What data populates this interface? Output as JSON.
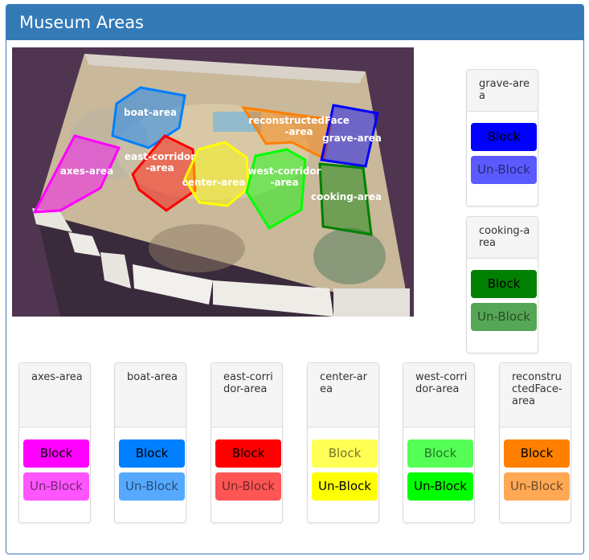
{
  "panel": {
    "title": "Museum Areas"
  },
  "map": {
    "labels": {
      "boat": "boat-area",
      "reconstructed_1": "reconstructedFace",
      "reconstructed_2": "-area",
      "grave": "grave-area",
      "east_1": "east-corridor",
      "east_2": "-area",
      "axes": "axes-area",
      "center": "center-area",
      "west_1": "west-corridor",
      "west_2": "-area",
      "cooking": "cooking-area"
    }
  },
  "cards": {
    "grave": {
      "name": "grave-area",
      "block": "Block",
      "unblock": "Un-Block",
      "color": "#0000ff",
      "state": "blocked"
    },
    "cooking": {
      "name": "cooking-area",
      "block": "Block",
      "unblock": "Un-Block",
      "color": "#008000",
      "state": "blocked"
    },
    "axes": {
      "name": "axes-area",
      "block": "Block",
      "unblock": "Un-Block",
      "color": "#ff00ff",
      "state": "blocked"
    },
    "boat": {
      "name": "boat-area",
      "block": "Block",
      "unblock": "Un-Block",
      "color": "#007fff",
      "state": "blocked"
    },
    "east": {
      "name": "east-corridor-area",
      "block": "Block",
      "unblock": "Un-Block",
      "color": "#ff0000",
      "state": "blocked"
    },
    "center": {
      "name": "center-area",
      "block": "Block",
      "unblock": "Un-Block",
      "color": "#ffff00",
      "state": "unblocked"
    },
    "west": {
      "name": "west-corridor-area",
      "block": "Block",
      "unblock": "Un-Block",
      "color": "#00ff00",
      "state": "unblocked"
    },
    "reconstructed": {
      "name": "reconstructedFace-area",
      "block": "Block",
      "unblock": "Un-Block",
      "color": "#ff7f00",
      "state": "blocked"
    }
  }
}
